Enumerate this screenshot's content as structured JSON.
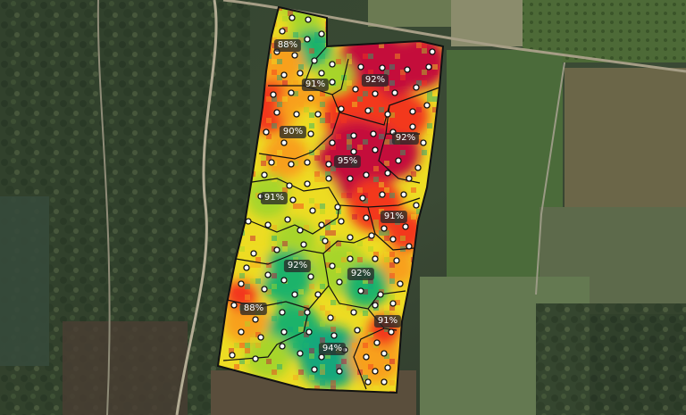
{
  "map": {
    "zone_labels": [
      "88%",
      "91%",
      "92%",
      "90%",
      "92%",
      "95%",
      "91%",
      "91%",
      "92%",
      "92%",
      "88%",
      "91%",
      "94%"
    ]
  },
  "colors": {
    "high": "#c40f3a",
    "upper": "#f3391f",
    "mid_high": "#f8a01e",
    "mid": "#eddc23",
    "mid_low": "#a7d52c",
    "low": "#1fb36b",
    "lowest": "#14a77c"
  }
}
